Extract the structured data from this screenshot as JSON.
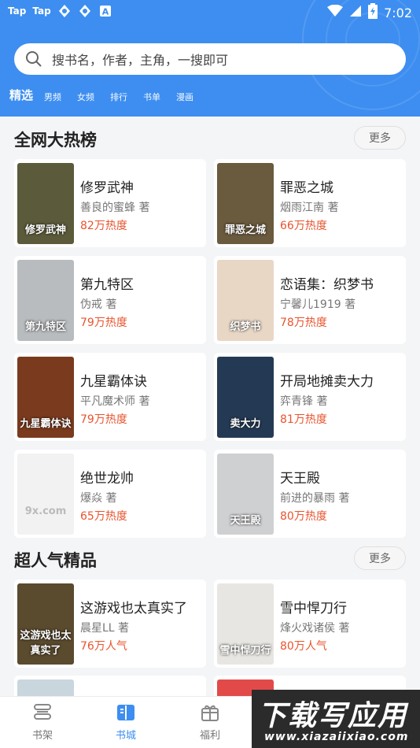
{
  "statusbar": {
    "left_labels": [
      "Tap",
      "Tap"
    ],
    "time": "7:02",
    "icons": [
      "taptap-icon",
      "taptap-icon",
      "sync-icon",
      "sync-icon",
      "a-icon",
      "wifi-icon",
      "signal-icon",
      "battery-icon"
    ]
  },
  "search": {
    "placeholder": "搜书名，作者，主角，一搜即可"
  },
  "tabs": [
    "精选",
    "男频",
    "女频",
    "排行",
    "书单",
    "漫画"
  ],
  "sections": [
    {
      "title": "全网大热榜",
      "more": "更多",
      "books": [
        {
          "title": "修罗武神",
          "author": "善良的蜜蜂 著",
          "heat": "82万热度",
          "cover_text": "修罗武神",
          "cover_bg": "#5b5a3a"
        },
        {
          "title": "罪恶之城",
          "author": "烟雨江南 著",
          "heat": "66万热度",
          "cover_text": "罪恶之城",
          "cover_bg": "#6a5a3e"
        },
        {
          "title": "第九特区",
          "author": "伪戒 著",
          "heat": "79万热度",
          "cover_text": "第九特区",
          "cover_bg": "#b9bcbf"
        },
        {
          "title": "恋语集：织梦书",
          "author": "宁馨儿1919 著",
          "heat": "78万热度",
          "cover_text": "织梦书",
          "cover_bg": "#e9d7c6"
        },
        {
          "title": "九星霸体诀",
          "author": "平凡魔术师 著",
          "heat": "79万热度",
          "cover_text": "九星霸体诀",
          "cover_bg": "#7a3a1e"
        },
        {
          "title": "开局地摊卖大力",
          "author": "弈青锋 著",
          "heat": "81万热度",
          "cover_text": "卖大力",
          "cover_bg": "#243a54"
        },
        {
          "title": "绝世龙帅",
          "author": "爆焱 著",
          "heat": "65万热度",
          "cover_text": "9x.com",
          "cover_bg": "#f2f2f2"
        },
        {
          "title": "天王殿",
          "author": "前进的暴雨 著",
          "heat": "80万热度",
          "cover_text": "天王殿",
          "cover_bg": "#cfd0d2"
        }
      ]
    },
    {
      "title": "超人气精品",
      "more": "更多",
      "books": [
        {
          "title": "这游戏也太真实了",
          "author": "晨星LL 著",
          "heat": "76万人气",
          "cover_text": "这游戏也太真实了",
          "cover_bg": "#5a4a2e"
        },
        {
          "title": "雪中悍刀行",
          "author": "烽火戏诸侯 著",
          "heat": "80万人气",
          "cover_text": "雪中悍刀行",
          "cover_bg": "#e8e6e2"
        }
      ]
    }
  ],
  "bottomnav": [
    {
      "label": "书架",
      "icon": "bookshelf-icon",
      "active": false
    },
    {
      "label": "书城",
      "icon": "book-open-icon",
      "active": true
    },
    {
      "label": "福利",
      "icon": "gift-icon",
      "active": false
    }
  ],
  "watermark": {
    "main": "下载写应用",
    "url": "www.xiazaiixiao.com"
  },
  "colors": {
    "header": "#3d8ef0",
    "heat": "#e8542e",
    "accent": "#3d8ef0"
  }
}
